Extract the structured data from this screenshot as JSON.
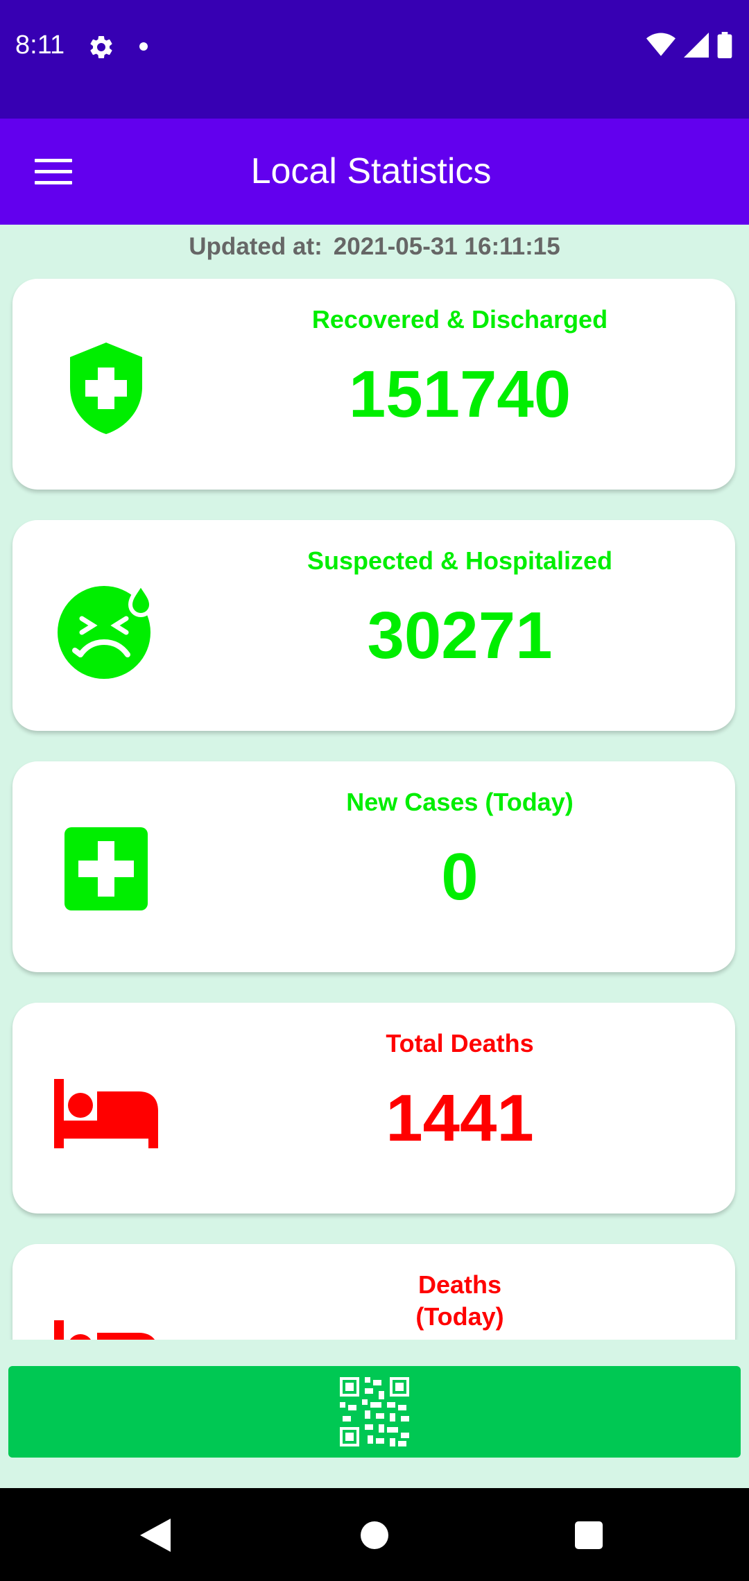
{
  "status_bar": {
    "time": "8:11",
    "icons": [
      "settings-gear-icon",
      "notification-dot-icon",
      "wifi-icon",
      "cellular-signal-icon",
      "battery-icon"
    ]
  },
  "app_bar": {
    "title": "Local Statistics",
    "menu_icon": "hamburger-menu-icon"
  },
  "updated": {
    "label": "Updated at:",
    "value": "2021-05-31 16:11:15"
  },
  "cards": [
    {
      "label": "Recovered & Discharged",
      "value": "151740",
      "icon": "shield-plus-icon",
      "color": "#00ee00"
    },
    {
      "label": "Suspected & Hospitalized",
      "value": "30271",
      "icon": "sick-face-icon",
      "color": "#00ee00"
    },
    {
      "label": "New Cases (Today)",
      "value": "0",
      "icon": "medical-cross-icon",
      "color": "#00ee00"
    },
    {
      "label": "Total Deaths",
      "value": "1441",
      "icon": "hotel-bed-icon",
      "color": "#ff0000"
    },
    {
      "label": "Deaths\n(Today)",
      "value": "",
      "icon": "hotel-bed-icon",
      "color": "#ff0000"
    }
  ],
  "bottom_button": {
    "icon": "qr-code-icon",
    "color": "#00c853"
  },
  "colors": {
    "status_bar": "#3700b3",
    "app_bar": "#6200ee",
    "background": "#d6f5e6"
  }
}
